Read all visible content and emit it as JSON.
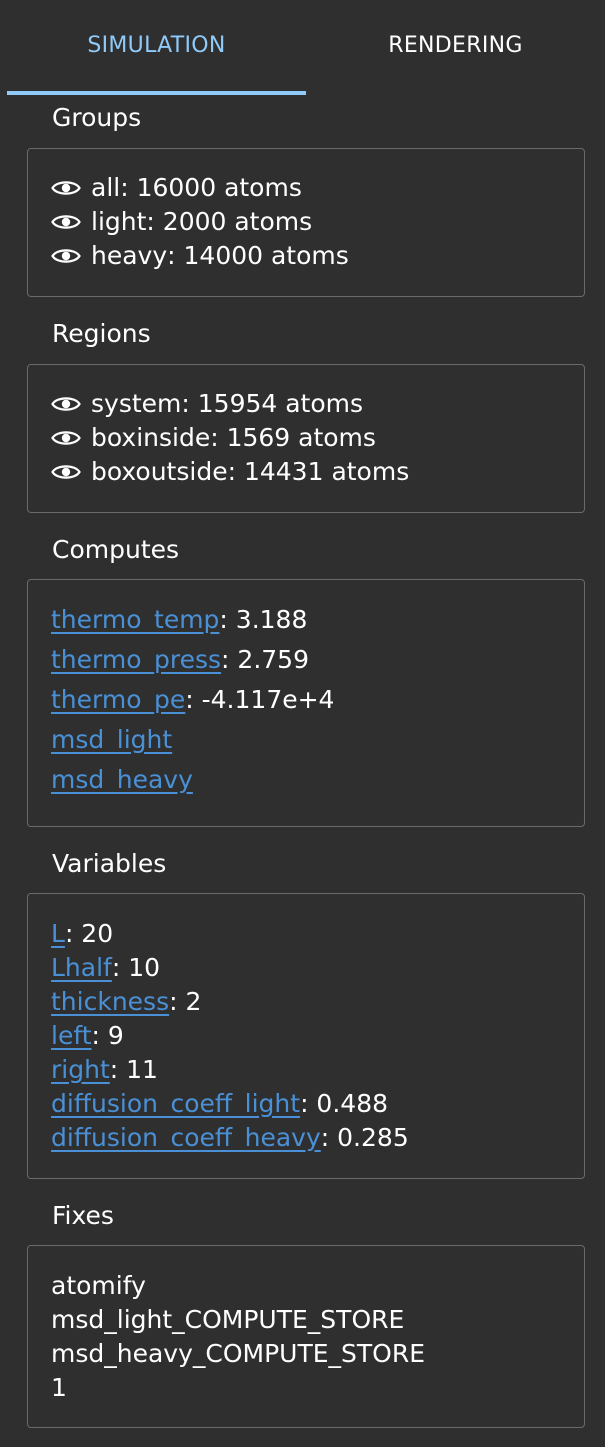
{
  "tabs": {
    "simulation": "SIMULATION",
    "rendering": "RENDERING"
  },
  "groups": {
    "title": "Groups",
    "items": [
      {
        "name": "all",
        "value": ": 16000 atoms"
      },
      {
        "name": "light",
        "value": ": 2000 atoms"
      },
      {
        "name": "heavy",
        "value": ": 14000 atoms"
      }
    ]
  },
  "regions": {
    "title": "Regions",
    "items": [
      {
        "name": "system",
        "value": ": 15954 atoms"
      },
      {
        "name": "boxinside",
        "value": ": 1569 atoms"
      },
      {
        "name": "boxoutside",
        "value": ": 14431 atoms"
      }
    ]
  },
  "computes": {
    "title": "Computes",
    "items": [
      {
        "name": "thermo_temp",
        "value": ": 3.188"
      },
      {
        "name": "thermo_press",
        "value": ": 2.759"
      },
      {
        "name": "thermo_pe",
        "value": ": -4.117e+4"
      },
      {
        "name": "msd_light",
        "value": ""
      },
      {
        "name": "msd_heavy",
        "value": ""
      }
    ]
  },
  "variables": {
    "title": "Variables",
    "items": [
      {
        "name": "L",
        "value": ": 20"
      },
      {
        "name": "Lhalf",
        "value": ": 10"
      },
      {
        "name": "thickness",
        "value": ": 2"
      },
      {
        "name": "left",
        "value": ": 9"
      },
      {
        "name": "right",
        "value": ": 11"
      },
      {
        "name": "diffusion_coeff_light",
        "value": ": 0.488"
      },
      {
        "name": "diffusion_coeff_heavy",
        "value": ": 0.285"
      }
    ]
  },
  "fixes": {
    "title": "Fixes",
    "items": [
      "atomify",
      "msd_light_COMPUTE_STORE",
      "msd_heavy_COMPUTE_STORE",
      "1"
    ]
  },
  "colors": {
    "background": "#2f2f2f",
    "accent": "#90caf9",
    "link": "#4a90d6",
    "border": "#6a6a6a"
  },
  "icons": {
    "visibility": "eye-icon"
  }
}
